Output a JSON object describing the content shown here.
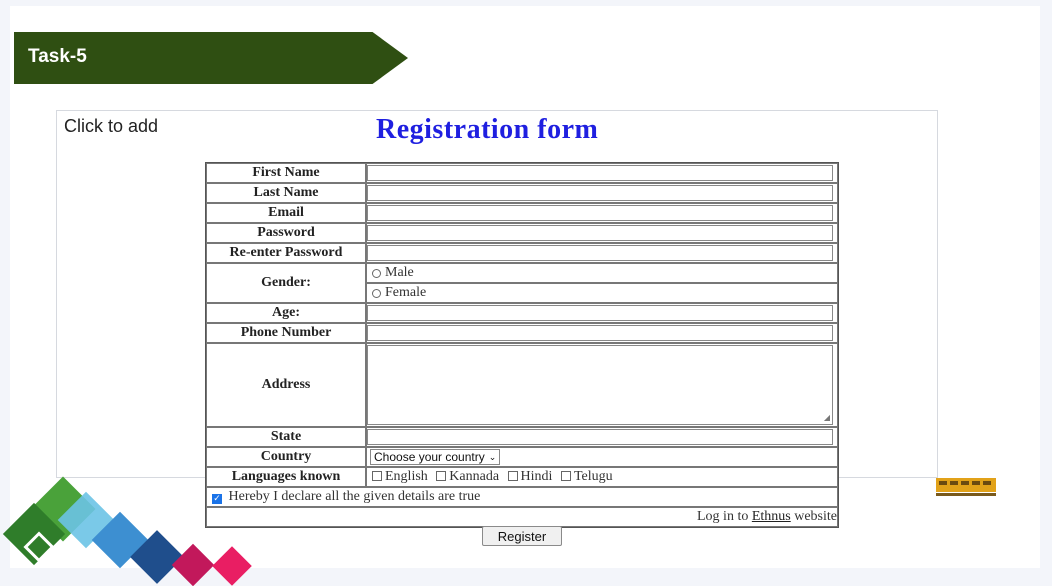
{
  "task_label": "Task-5",
  "placeholder_text": "Click to add",
  "form": {
    "title": "Registration form",
    "fields": {
      "first_name": "First Name",
      "last_name": "Last Name",
      "email": "Email",
      "password": "Password",
      "reenter_password": "Re-enter Password",
      "gender": "Gender:",
      "age": "Age:",
      "phone": "Phone Number",
      "address": "Address",
      "state": "State",
      "country": "Country",
      "languages": "Languages known"
    },
    "gender_options": [
      "Male",
      "Female"
    ],
    "country_select": "Choose your country",
    "languages": [
      "English",
      "Kannada",
      "Hindi",
      "Telugu"
    ],
    "declaration": "Hereby I declare all the given details are true",
    "declaration_checked": true,
    "login_prefix": "Log in to",
    "login_link": "Ethnus",
    "login_suffix": "website",
    "register_button": "Register"
  },
  "colors": {
    "banner": "#2f4f12",
    "title": "#1f1fe0",
    "checkbox_checked": "#1a73e8"
  },
  "icons": [
    "select-chevron-icon",
    "resize-grip-icon",
    "checkmark-icon",
    "train-icon"
  ]
}
